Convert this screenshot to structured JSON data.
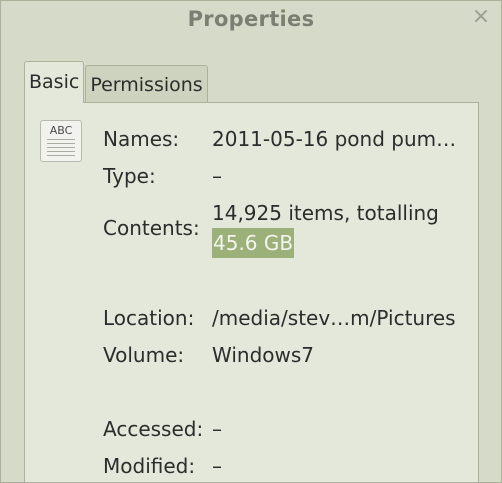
{
  "window": {
    "title": "Properties",
    "close_glyph": "×"
  },
  "tabs": [
    {
      "label": "Basic",
      "active": true
    },
    {
      "label": "Permissions",
      "active": false
    }
  ],
  "file": {
    "icon": "text-file-icon",
    "icon_label": "ABC"
  },
  "fields": {
    "names": {
      "label": "Names:",
      "value": "2011-05-16 pond pum…"
    },
    "type": {
      "label": "Type:",
      "value": "–"
    },
    "contents": {
      "label": "Contents:",
      "value_line1": "14,925 items, totalling",
      "value_line2": "45.6 GB"
    },
    "location": {
      "label": "Location:",
      "value": "/media/stev…m/Pictures"
    },
    "volume": {
      "label": "Volume:",
      "value": "Windows7"
    },
    "accessed": {
      "label": "Accessed:",
      "value": "–"
    },
    "modified": {
      "label": "Modified:",
      "value": "–"
    }
  },
  "colors": {
    "background": "#d6dbc9",
    "panel": "#e4e8da",
    "selection_highlight": "#9cb07a"
  }
}
